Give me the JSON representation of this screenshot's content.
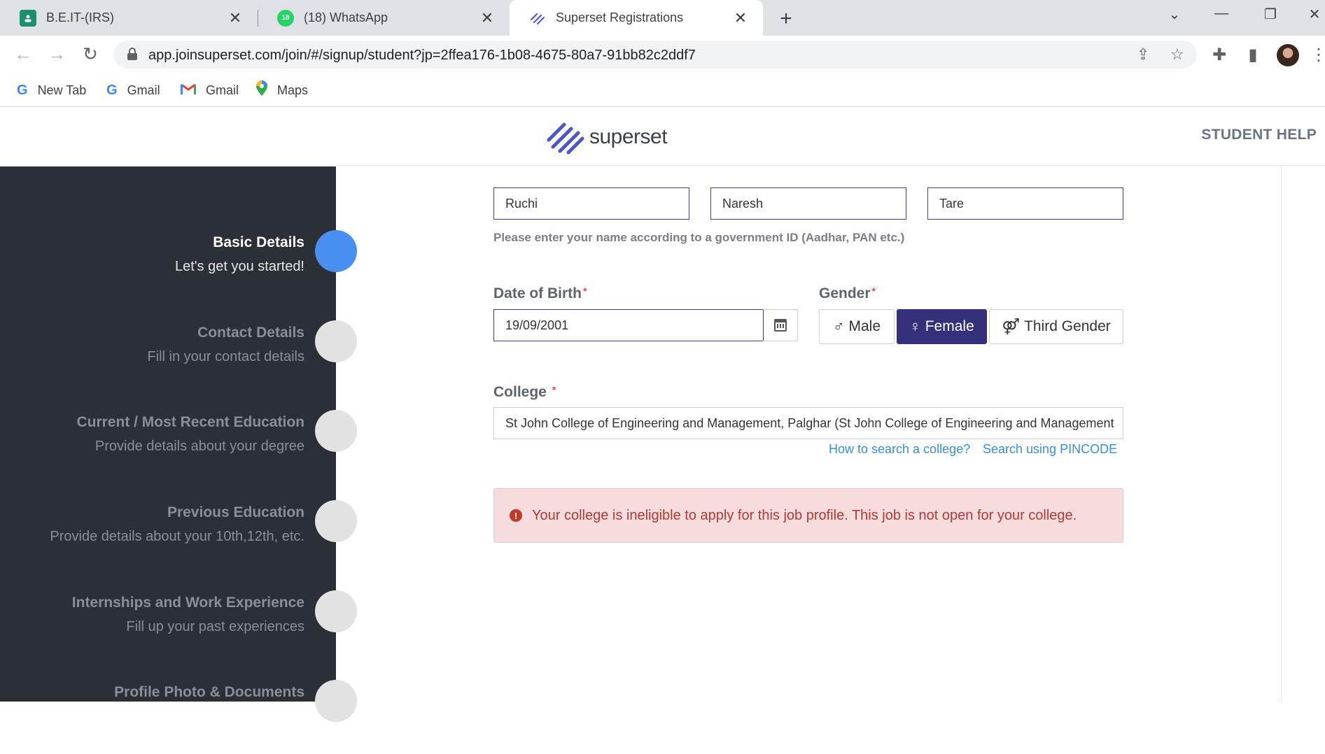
{
  "browser": {
    "tabs": [
      {
        "title": "B.E.IT-(IRS)",
        "icon": "classroom-icon"
      },
      {
        "title": "(18) WhatsApp",
        "icon": "whatsapp-icon",
        "badge": "18"
      },
      {
        "title": "Superset Registrations",
        "icon": "superset-icon",
        "active": true
      }
    ],
    "url": "app.joinsuperset.com/join/#/signup/student?jp=2ffea176-1b08-4675-80a7-91bb82c2ddf7",
    "bookmarks": [
      {
        "label": "New Tab",
        "icon": "google-icon"
      },
      {
        "label": "Gmail",
        "icon": "google-icon"
      },
      {
        "label": "Gmail",
        "icon": "gmail-icon"
      },
      {
        "label": "Maps",
        "icon": "maps-icon"
      }
    ],
    "colors": {
      "tabstrip": "#dee1e6",
      "active_tab": "#ffffff"
    }
  },
  "header": {
    "logo_text": "superset",
    "help_label": "STUDENT HELP"
  },
  "sidebar": {
    "steps": [
      {
        "title": "Basic Details",
        "subtitle": "Let's get you started!",
        "active": true
      },
      {
        "title": "Contact Details",
        "subtitle": "Fill in your contact details"
      },
      {
        "title": "Current / Most Recent Education",
        "subtitle": "Provide details about your degree"
      },
      {
        "title": "Previous Education",
        "subtitle": "Provide details about your 10th,12th, etc."
      },
      {
        "title": "Internships and Work Experience",
        "subtitle": "Fill up your past experiences"
      },
      {
        "title": "Profile Photo & Documents",
        "subtitle": ""
      }
    ],
    "colors": {
      "background": "#2b2f36",
      "active_dot": "#4a8ff0",
      "inactive_dot": "#e2e2e2"
    }
  },
  "form": {
    "first_name": "Ruchi",
    "middle_name": "Naresh",
    "last_name": "Tare",
    "name_hint": "Please enter your name according to a government ID (Aadhar, PAN etc.)",
    "dob_label": "Date of Birth",
    "dob_value": "19/09/2001",
    "required_mark": "*",
    "gender_label": "Gender",
    "gender_options": [
      {
        "label": "Male",
        "symbol": "♂"
      },
      {
        "label": "Female",
        "symbol": "♀",
        "selected": true
      },
      {
        "label": "Third Gender",
        "symbol": "⚤"
      }
    ],
    "college_label": "College",
    "college_value": "St John College of Engineering and Management, Palghar (St John College of Engineering and Management",
    "links": {
      "how_to_search": "How to search a college?",
      "search_pincode": "Search using PINCODE"
    },
    "error_message": "Your college is ineligible to apply for this job profile. This job is not open for your college.",
    "colors": {
      "selected_gender": "#35307a",
      "link": "#3a8ed8",
      "error_bg": "#f6dcdc",
      "error_text": "#b13a35"
    }
  }
}
